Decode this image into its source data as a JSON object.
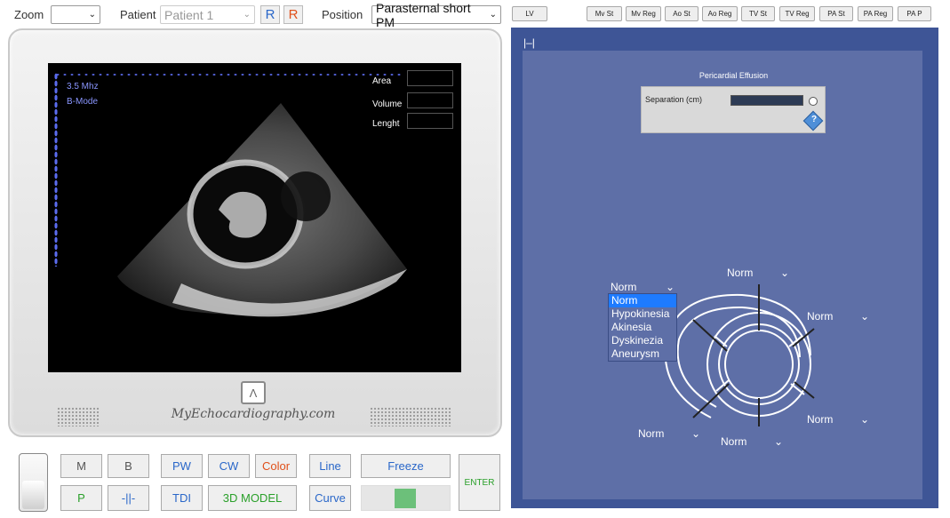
{
  "toolbar": {
    "zoom_label": "Zoom",
    "zoom_value": "",
    "patient_label": "Patient",
    "patient_value": "Patient 1",
    "r_blue": "R",
    "r_orange": "R",
    "position_label": "Position",
    "position_value": "Parasternal short PM",
    "lv_button": "LV",
    "view_buttons": [
      "Mv St",
      "Mv Reg",
      "Ao St",
      "Ao Reg",
      "TV St",
      "TV Reg",
      "PA St",
      "PA Reg",
      "PA P"
    ]
  },
  "monitor": {
    "frequency": "3.5 Mhz",
    "mode": "B-Mode",
    "area_label": "Area",
    "volume_label": "Volume",
    "length_label": "Lenght",
    "brand": "MyEchocardiography.com"
  },
  "controls": {
    "m": "M",
    "b": "B",
    "pw": "PW",
    "cw": "CW",
    "color": "Color",
    "line": "Line",
    "freeze": "Freeze",
    "p": "P",
    "split": "-||-",
    "tdi": "TDI",
    "model3d": "3D MODEL",
    "curve": "Curve",
    "enter": "ENTER"
  },
  "panel": {
    "collapse_icon": "|–|",
    "effusion_title": "Pericardial Effusion",
    "separation_label": "Separation (cm)",
    "segments": {
      "top": "Norm",
      "left_top": "Norm",
      "right_top": "Norm",
      "right_bottom": "Norm",
      "bottom": "Norm",
      "left_bottom": "Norm"
    },
    "options": [
      "Norm",
      "Hypokinesia",
      "Akinesia",
      "Dyskinezia",
      "Aneurysm"
    ]
  },
  "colors": {
    "panel_bg": "#3e5596",
    "panel_inner": "#5e6fa7",
    "highlight": "#1e7bff",
    "blue_text": "#2a67c9",
    "orange_text": "#e0501a",
    "green_text": "#2aa02a"
  }
}
